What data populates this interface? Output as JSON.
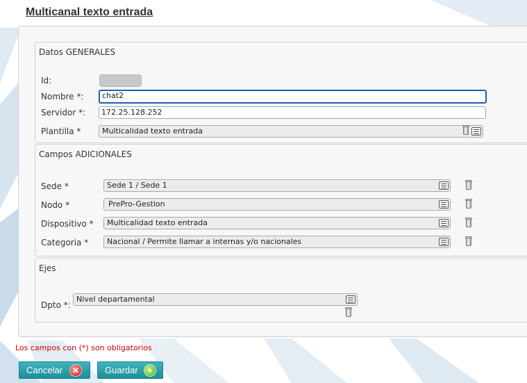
{
  "page": {
    "title": "Multicanal texto entrada"
  },
  "general": {
    "legend": "Datos GENERALES",
    "id": {
      "label": "Id:",
      "value": ""
    },
    "nombre": {
      "label": "Nombre *:",
      "value": "chat2"
    },
    "servidor": {
      "label": "Servidor *:",
      "value": "172.25.128.252"
    },
    "plantilla": {
      "label": "Plantilla *",
      "value": "Multicalidad texto entrada"
    }
  },
  "adicionales": {
    "legend": "Campos ADICIONALES",
    "sede": {
      "label": "Sede *",
      "value": "Sede 1 / Sede 1"
    },
    "nodo": {
      "label": "Nodo *",
      "value": "PrePro-Gestion"
    },
    "dispositivo": {
      "label": "Dispositivo *",
      "value": "Multicalidad texto entrada"
    },
    "categoria": {
      "label": "Categoria *",
      "value": "Nacional / Permite llamar a internas y/o nacionales"
    }
  },
  "ejes": {
    "legend": "Ejes",
    "dpto": {
      "label": "Dpto *:",
      "value": "Nivel departamental"
    }
  },
  "footer": {
    "required_note": "Los campos con (*) son obligatorios",
    "cancel_label": "Cancelar",
    "save_label": "Guardar"
  },
  "icons": {
    "list": "list-icon",
    "trash": "trash-icon",
    "cancel": "cancel-circle-icon",
    "add": "add-circle-icon"
  },
  "colors": {
    "button": "#2aa3ad",
    "required_text": "#cc0000",
    "focus_border": "#1f5fa8"
  }
}
